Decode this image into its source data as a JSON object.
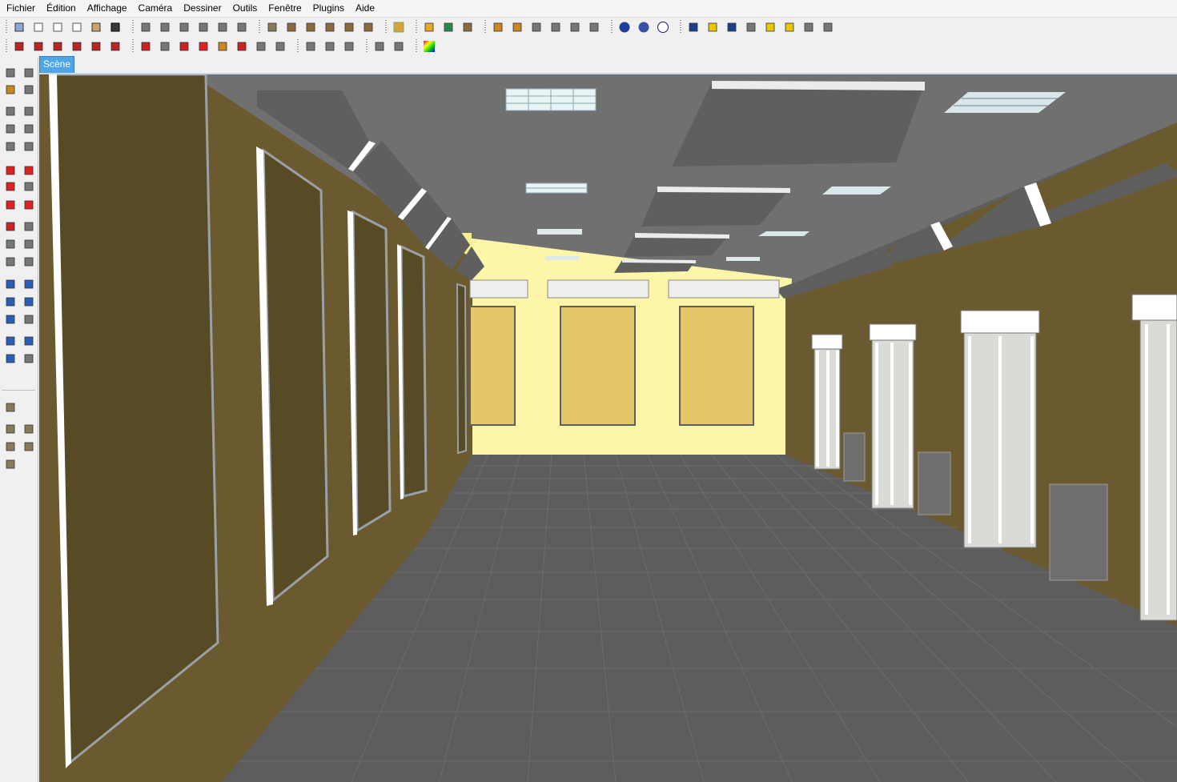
{
  "menu": [
    {
      "id": "fichier",
      "label": "Fichier"
    },
    {
      "id": "edition",
      "label": "Édition"
    },
    {
      "id": "affichage",
      "label": "Affichage"
    },
    {
      "id": "camera",
      "label": "Caméra"
    },
    {
      "id": "dessiner",
      "label": "Dessiner"
    },
    {
      "id": "outils",
      "label": "Outils"
    },
    {
      "id": "fenetre",
      "label": "Fenêtre"
    },
    {
      "id": "plugins",
      "label": "Plugins"
    },
    {
      "id": "aide",
      "label": "Aide"
    }
  ],
  "scene_tab": {
    "label": "Scène"
  },
  "toolbar_row1": [
    [
      "iso-view-icon",
      "top-view-icon",
      "front-view-icon",
      "right-view-icon",
      "back-view-icon",
      "left-view-icon"
    ],
    [
      "xray-style-icon",
      "wireframe-style-icon",
      "hidden-line-style-icon",
      "shaded-style-icon",
      "shaded-textures-style-icon",
      "monochrome-style-icon"
    ],
    [
      "component-icon",
      "door-icon",
      "house-icon",
      "roof-icon",
      "outline-house-icon",
      "window-block-icon"
    ],
    [
      "fire-icon"
    ],
    [
      "folder-icon",
      "globe-icon",
      "warehouse-share-icon"
    ],
    [
      "pencil-icon",
      "eyedropper-icon",
      "section-icon",
      "fd-icon",
      "plant-icon",
      "render-icon"
    ],
    [
      "help-icon",
      "help-search-icon",
      "info-icon"
    ],
    [
      "layer-blue-icon",
      "layer-yellow-icon",
      "film-icon",
      "person-icon",
      "arrow-yellow-icon",
      "bulb-icon",
      "tile-icon",
      "palette-icon"
    ]
  ],
  "toolbar_row2": [
    [
      "film-red-1-icon",
      "film-red-2-icon",
      "film-red-3-icon",
      "film-red-4-icon",
      "film-red-5-icon",
      "film-red-6-icon"
    ],
    [
      "measure-icon",
      "cylinder-icon",
      "rotate-ring-icon",
      "move-points-icon",
      "paint-bucket-icon",
      "red-star-icon",
      "scatter-icon",
      "frame-icon"
    ],
    [
      "section-box-icon",
      "eye-icon",
      "stairs-icon"
    ],
    [
      "help-doc-icon",
      "web-icon"
    ],
    [
      "rainbow-icon"
    ]
  ],
  "left_tools": [
    [
      "select-icon",
      "eraser-outline-icon"
    ],
    [
      "paint-icon",
      "eraser-icon"
    ],
    [
      "rectangle-icon",
      "line-icon"
    ],
    [
      "circle-icon",
      "arc-icon"
    ],
    [
      "polygon-icon",
      "freehand-icon"
    ],
    [
      "move-icon",
      "push-pull-icon"
    ],
    [
      "rotate-icon",
      "follow-me-icon"
    ],
    [
      "scale-icon",
      "offset-icon"
    ],
    [
      "tape-measure-icon",
      "dimension-icon"
    ],
    [
      "protractor-icon",
      "text-icon"
    ],
    [
      "axes-icon",
      "3d-text-icon"
    ],
    [
      "orbit-icon",
      "pan-icon"
    ],
    [
      "zoom-icon",
      "zoom-window-icon"
    ],
    [
      "zoom-extents-icon",
      "previous-view-icon"
    ],
    [
      "position-camera-icon",
      "look-around-icon"
    ],
    [
      "walk-icon",
      "section-plane-icon"
    ],
    [
      "component-a-icon"
    ],
    [
      "component-b-icon",
      "component-c-icon"
    ],
    [
      "component-d-icon",
      "component-e-icon"
    ],
    [
      "component-f-icon"
    ]
  ],
  "colors": {
    "wall_left": "#6b5a2f",
    "wall_right": "#6b5a2f",
    "back_wall": "#fdf6a8",
    "ceiling": "#707070",
    "floor": "#5d5d5d",
    "tile_line": "#6c6c6c",
    "board": "#574b26",
    "frame": "#ffffff",
    "accent_tab": "#4fa5e6"
  }
}
